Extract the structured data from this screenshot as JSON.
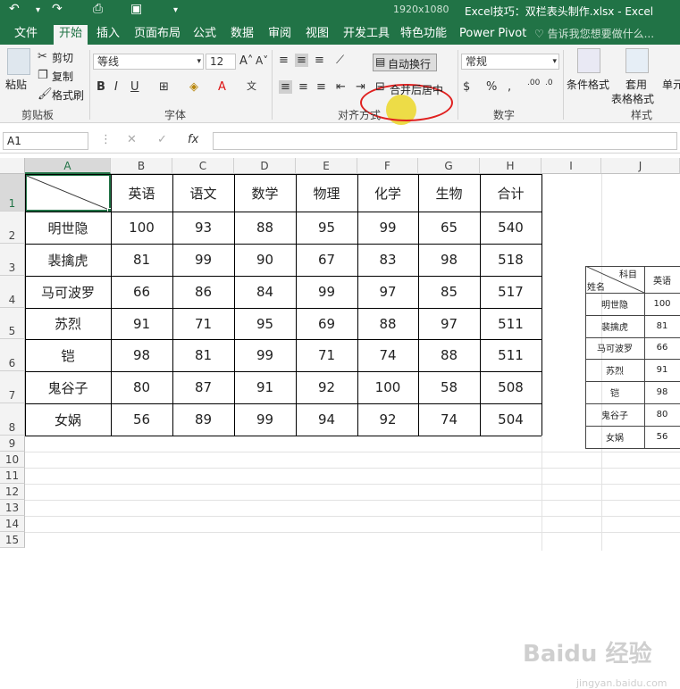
{
  "titlebar": {
    "title": "Excel技巧：双栏表头制作.xlsx - Excel",
    "resolution": "1920x1080"
  },
  "tabs": [
    "文件",
    "开始",
    "插入",
    "页面布局",
    "公式",
    "数据",
    "审阅",
    "视图",
    "开发工具",
    "特色功能",
    "Power Pivot",
    "告诉我您想要做什么..."
  ],
  "active_tab": "开始",
  "ribbon": {
    "clipboard": {
      "paste": "粘贴",
      "cut": "剪切",
      "copy": "复制",
      "format_painter": "格式刷",
      "label": "剪贴板"
    },
    "font": {
      "name": "等线",
      "size": "12",
      "label": "字体"
    },
    "alignment": {
      "wrap_text": "自动换行",
      "merge_center": "合并后居中",
      "label": "对齐方式"
    },
    "number": {
      "format": "常规",
      "label": "数字"
    },
    "styles": {
      "conditional": "条件格式",
      "table_format_1": "套用",
      "table_format_2": "表格格式",
      "cell_styles": "单元",
      "label": "样式"
    }
  },
  "formula_bar": {
    "name_box": "A1",
    "fx": "fx"
  },
  "columns": [
    "A",
    "B",
    "C",
    "D",
    "E",
    "F",
    "G",
    "H",
    "I",
    "J"
  ],
  "rows": [
    "1",
    "2",
    "3",
    "4",
    "5",
    "6",
    "7",
    "8",
    "9",
    "10",
    "11",
    "12",
    "13",
    "14",
    "15"
  ],
  "table": {
    "headers": [
      "英语",
      "语文",
      "数学",
      "物理",
      "化学",
      "生物",
      "合计"
    ],
    "data": [
      {
        "name": "明世隐",
        "values": [
          "100",
          "93",
          "88",
          "95",
          "99",
          "65",
          "540"
        ]
      },
      {
        "name": "裴擒虎",
        "values": [
          "81",
          "99",
          "90",
          "67",
          "83",
          "98",
          "518"
        ]
      },
      {
        "name": "马可波罗",
        "values": [
          "66",
          "86",
          "84",
          "99",
          "97",
          "85",
          "517"
        ]
      },
      {
        "name": "苏烈",
        "values": [
          "91",
          "71",
          "95",
          "69",
          "88",
          "97",
          "511"
        ]
      },
      {
        "name": "铠",
        "values": [
          "98",
          "81",
          "99",
          "71",
          "74",
          "88",
          "511"
        ]
      },
      {
        "name": "鬼谷子",
        "values": [
          "80",
          "87",
          "91",
          "92",
          "100",
          "58",
          "508"
        ]
      },
      {
        "name": "女娲",
        "values": [
          "56",
          "89",
          "99",
          "94",
          "92",
          "74",
          "504"
        ]
      }
    ]
  },
  "mini_table": {
    "corner_top": "科目",
    "corner_bottom": "姓名",
    "header": "英语",
    "rows": [
      {
        "name": "明世隐",
        "value": "100"
      },
      {
        "name": "裴擒虎",
        "value": "81"
      },
      {
        "name": "马可波罗",
        "value": "66"
      },
      {
        "name": "苏烈",
        "value": "91"
      },
      {
        "name": "铠",
        "value": "98"
      },
      {
        "name": "鬼谷子",
        "value": "80"
      },
      {
        "name": "女娲",
        "value": "56"
      }
    ]
  },
  "watermark": {
    "main": "Baidu 经验",
    "sub": "jingyan.baidu.com"
  },
  "colors": {
    "excel_green": "#217346",
    "highlight_red": "#e0201f",
    "cursor_yellow": "#ebd728"
  }
}
